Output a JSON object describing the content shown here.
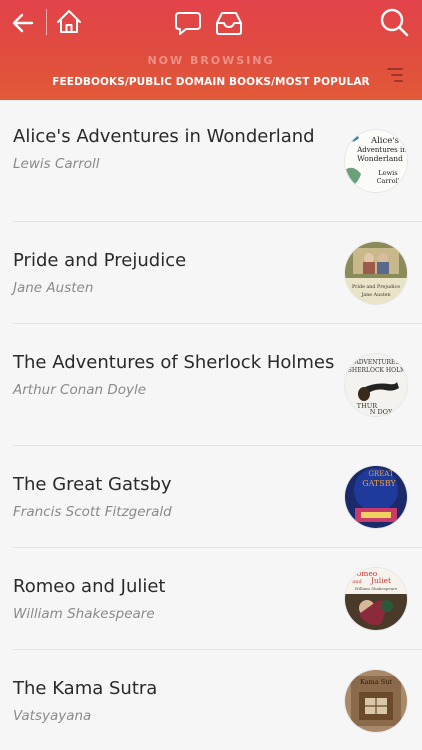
{
  "header": {
    "subtitle": "NOW BROWSING",
    "breadcrumb": "FEEDBOOKS/PUBLIC DOMAIN BOOKS/MOST POPULAR",
    "icons": [
      "back-arrow-icon",
      "home-icon",
      "chat-bubble-icon",
      "inbox-tray-icon",
      "search-icon",
      "menu-lines-icon"
    ],
    "gradient_colors": [
      "#e2424a",
      "#e25a38"
    ]
  },
  "books": [
    {
      "title": "Alice's Adventures in Wonderland",
      "author": "Lewis Carroll",
      "cover": {
        "lines": [
          "Alice's",
          "Adventures in",
          "Wonderland",
          "Lewis",
          "Carrol'"
        ]
      }
    },
    {
      "title": "Pride and Prejudice",
      "author": "Jane Austen",
      "cover": {
        "lines": [
          "Pride and Prejudice",
          "Jane Austen"
        ]
      }
    },
    {
      "title": "The Adventures of Sherlock Holmes",
      "author": "Arthur Conan Doyle",
      "cover": {
        "lines": [
          "ADVENTURES",
          "SHERLOCK HOLM",
          "THUR",
          "N DOY"
        ]
      }
    },
    {
      "title": "The Great Gatsby",
      "author": "Francis Scott Fitzgerald",
      "cover": {
        "lines": [
          "GREAT",
          "GATSBY"
        ]
      }
    },
    {
      "title": "Romeo and Juliet",
      "author": "William Shakespeare",
      "cover": {
        "lines": [
          "omeo",
          "and",
          "Juliet",
          "William Shakespeare"
        ]
      }
    },
    {
      "title": "The Kama Sutra",
      "author": "Vatsyayana",
      "cover": {
        "lines": [
          "Kama Sut"
        ]
      }
    }
  ]
}
